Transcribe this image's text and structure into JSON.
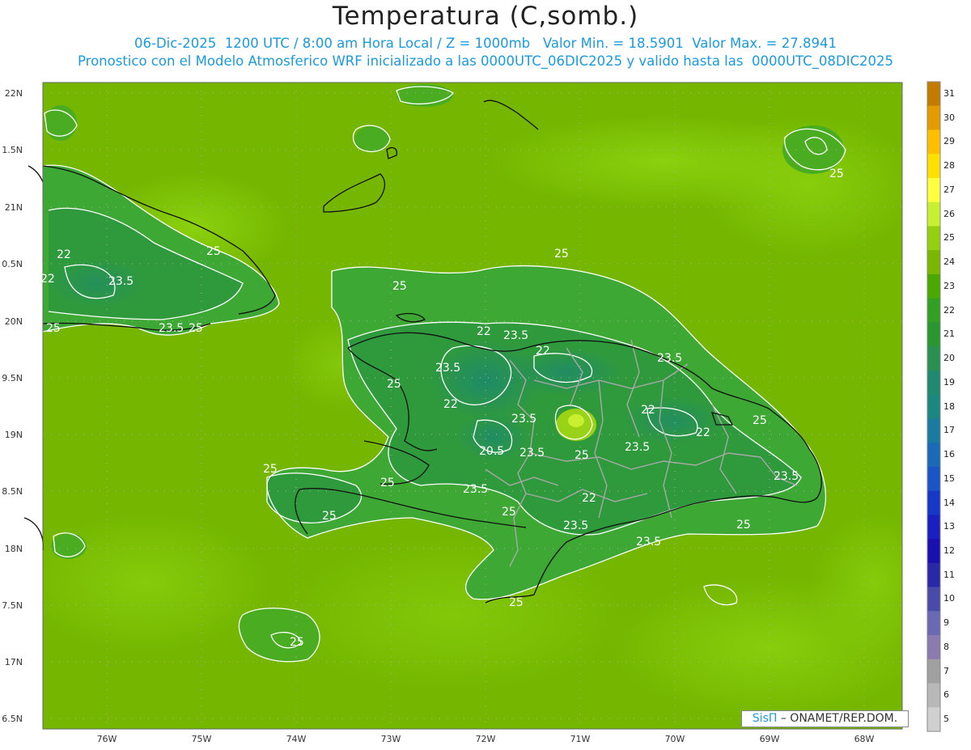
{
  "title": "Temperatura (C,somb.)",
  "subtitle1": "06-Dic-2025  1200 UTC / 8:00 am Hora Local / Z = 1000mb   Valor Min. = 18.5901  Valor Max. = 27.8941",
  "subtitle2": "Pronostico con el Modelo Atmosferico WRF inicializado a las 0000UTC_06DIC2025 y valido hasta las  0000UTC_08DIC2025",
  "variable": "Temperatura",
  "units": "C",
  "level": "1000mb",
  "date": "06-Dic-2025",
  "time_utc": "1200 UTC",
  "local_time": "8:00 am Hora Local",
  "value_min": 18.5901,
  "value_max": 27.8941,
  "y_axis": {
    "ticks": [
      "22N",
      "1.5N",
      "21N",
      "0.5N",
      "20N",
      "9.5N",
      "19N",
      "8.5N",
      "18N",
      "7.5N",
      "17N",
      "6.5N"
    ]
  },
  "x_axis": {
    "ticks": [
      "76W",
      "75W",
      "74W",
      "73W",
      "72W",
      "71W",
      "70W",
      "69W",
      "68W"
    ]
  },
  "colorbar": {
    "levels": [
      "31",
      "30",
      "29",
      "28",
      "27",
      "26",
      "25",
      "24",
      "23",
      "22",
      "21",
      "20",
      "19",
      "18",
      "17",
      "16",
      "15",
      "14",
      "13",
      "12",
      "11",
      "10",
      "9",
      "8",
      "7",
      "6",
      "5"
    ],
    "colors": [
      "#c47c00",
      "#e39b00",
      "#ffbf00",
      "#ffe000",
      "#ffff40",
      "#c8f030",
      "#92d010",
      "#7ab800",
      "#4aa800",
      "#33a024",
      "#2a9630",
      "#2a9050",
      "#208a70",
      "#1a8880",
      "#1a7aa0",
      "#1a6ab8",
      "#1a55c8",
      "#1638c8",
      "#1a20c0",
      "#1a10b0",
      "#2828a8",
      "#4a4aa8",
      "#6a6ab4",
      "#8a7ab0",
      "#a0a0a0",
      "#b8b8b8",
      "#d0d0d0"
    ]
  },
  "contour_labels": {
    "c25": "25",
    "c235": "23.5",
    "c22": "22",
    "c205": "20.5"
  },
  "credit": {
    "logo": "SisΠ",
    "text": "– ONAMET/REP.DOM."
  }
}
